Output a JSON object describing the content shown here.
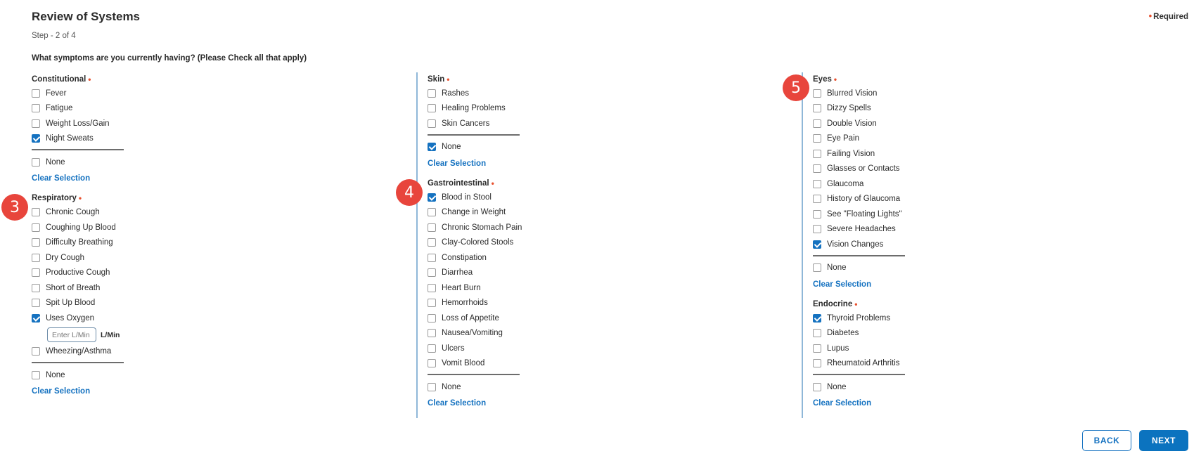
{
  "header": {
    "title": "Review of Systems",
    "step": "Step - 2 of 4",
    "required_dot": "•",
    "required_label": "Required"
  },
  "question": "What symptoms are you currently having? (Please Check all that apply)",
  "columns": [
    {
      "sections": [
        {
          "id": "constitutional",
          "title": "Constitutional",
          "options": [
            {
              "label": "Fever",
              "checked": false
            },
            {
              "label": "Fatigue",
              "checked": false
            },
            {
              "label": "Weight Loss/Gain",
              "checked": false
            },
            {
              "label": "Night Sweats",
              "checked": true
            }
          ],
          "none": {
            "label": "None",
            "checked": false
          },
          "clear_label": "Clear Selection"
        },
        {
          "id": "respiratory",
          "title": "Respiratory",
          "options": [
            {
              "label": "Chronic Cough",
              "checked": false
            },
            {
              "label": "Coughing Up Blood",
              "checked": false
            },
            {
              "label": "Difficulty Breathing",
              "checked": false
            },
            {
              "label": "Dry Cough",
              "checked": false
            },
            {
              "label": "Productive Cough",
              "checked": false
            },
            {
              "label": "Short of Breath",
              "checked": false
            },
            {
              "label": "Spit Up Blood",
              "checked": false
            },
            {
              "label": "Uses Oxygen",
              "checked": true,
              "input": {
                "placeholder": "Enter L/Min",
                "value": "",
                "unit": "L/Min"
              }
            },
            {
              "label": "Wheezing/Asthma",
              "checked": false
            }
          ],
          "none": {
            "label": "None",
            "checked": false
          },
          "clear_label": "Clear Selection"
        }
      ]
    },
    {
      "sections": [
        {
          "id": "skin",
          "title": "Skin",
          "options": [
            {
              "label": "Rashes",
              "checked": false
            },
            {
              "label": "Healing Problems",
              "checked": false
            },
            {
              "label": "Skin Cancers",
              "checked": false
            }
          ],
          "none": {
            "label": "None",
            "checked": true
          },
          "clear_label": "Clear Selection"
        },
        {
          "id": "gastrointestinal",
          "title": "Gastrointestinal",
          "options": [
            {
              "label": "Blood in Stool",
              "checked": true
            },
            {
              "label": "Change in Weight",
              "checked": false
            },
            {
              "label": "Chronic Stomach Pain",
              "checked": false
            },
            {
              "label": "Clay-Colored Stools",
              "checked": false
            },
            {
              "label": "Constipation",
              "checked": false
            },
            {
              "label": "Diarrhea",
              "checked": false
            },
            {
              "label": "Heart Burn",
              "checked": false
            },
            {
              "label": "Hemorrhoids",
              "checked": false
            },
            {
              "label": "Loss of Appetite",
              "checked": false
            },
            {
              "label": "Nausea/Vomiting",
              "checked": false
            },
            {
              "label": "Ulcers",
              "checked": false
            },
            {
              "label": "Vomit Blood",
              "checked": false
            }
          ],
          "none": {
            "label": "None",
            "checked": false
          },
          "clear_label": "Clear Selection"
        }
      ]
    },
    {
      "sections": [
        {
          "id": "eyes",
          "title": "Eyes",
          "options": [
            {
              "label": "Blurred Vision",
              "checked": false
            },
            {
              "label": "Dizzy Spells",
              "checked": false
            },
            {
              "label": "Double Vision",
              "checked": false
            },
            {
              "label": "Eye Pain",
              "checked": false
            },
            {
              "label": "Failing Vision",
              "checked": false
            },
            {
              "label": "Glasses or Contacts",
              "checked": false
            },
            {
              "label": "Glaucoma",
              "checked": false
            },
            {
              "label": "History of Glaucoma",
              "checked": false
            },
            {
              "label": "See \"Floating Lights\"",
              "checked": false
            },
            {
              "label": "Severe Headaches",
              "checked": false
            },
            {
              "label": "Vision Changes",
              "checked": true
            }
          ],
          "none": {
            "label": "None",
            "checked": false
          },
          "clear_label": "Clear Selection"
        },
        {
          "id": "endocrine",
          "title": "Endocrine",
          "options": [
            {
              "label": "Thyroid Problems",
              "checked": true
            },
            {
              "label": "Diabetes",
              "checked": false
            },
            {
              "label": "Lupus",
              "checked": false
            },
            {
              "label": "Rheumatoid Arthritis",
              "checked": false
            }
          ],
          "none": {
            "label": "None",
            "checked": false
          },
          "clear_label": "Clear Selection"
        }
      ]
    }
  ],
  "badges": [
    "3",
    "4",
    "5"
  ],
  "buttons": {
    "back": "BACK",
    "next": "NEXT"
  },
  "colors": {
    "accent": "#1572c0",
    "required": "#e8502e",
    "badge": "#e8453c"
  }
}
